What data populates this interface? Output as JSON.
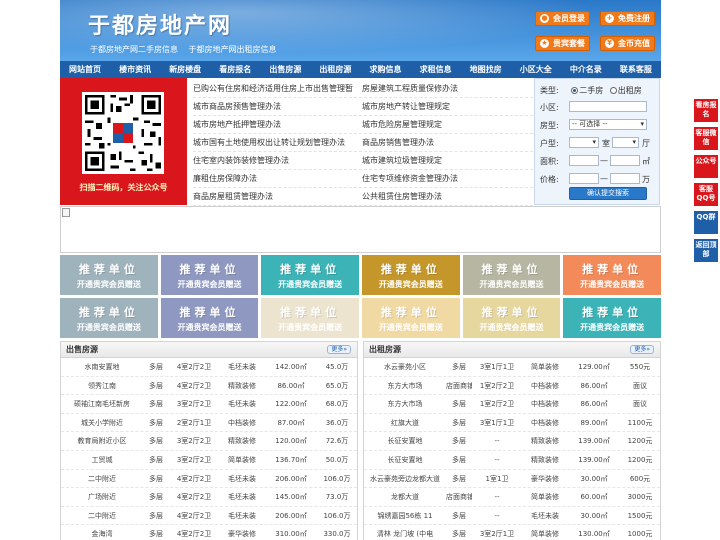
{
  "header": {
    "title": "于都房地产网",
    "sub_links": [
      "于都房地产网二手房信息",
      "于都房地产网出租房信息"
    ],
    "buttons": [
      {
        "label": "会员登录",
        "icon": "user-icon"
      },
      {
        "label": "免费注册",
        "icon": "register-icon"
      },
      {
        "label": "贵宾套餐",
        "icon": "vip-icon"
      },
      {
        "label": "金币充值",
        "icon": "coin-icon"
      }
    ]
  },
  "nav": [
    "网站首页",
    "楼市资讯",
    "新房楼盘",
    "看房报名",
    "出售房源",
    "出租房源",
    "求购信息",
    "求租信息",
    "地图找房",
    "小区大全",
    "中介名录",
    "联系客服"
  ],
  "qr": {
    "caption": "扫描二维码，关注公众号"
  },
  "links": [
    [
      "已购公有住房和经济适用住房上市出售管理暂",
      "房屋建筑工程质量保修办法"
    ],
    [
      "城市商品房预售管理办法",
      "城市房地产转让管理规定"
    ],
    [
      "城市房地产抵押管理办法",
      "城市危险房屋管理规定"
    ],
    [
      "城市国有土地使用权出让转让规划管理办法",
      "商品房销售管理办法"
    ],
    [
      "住宅室内装饰装修管理办法",
      "城市建筑垃圾管理规定"
    ],
    [
      "廉租住房保障办法",
      "住宅专项维修资金管理办法"
    ],
    [
      "商品房屋租赁管理办法",
      "公共租赁住房管理办法"
    ]
  ],
  "search": {
    "type_label": "类型:",
    "type_options": [
      "二手房",
      "出租房"
    ],
    "community_label": "小区:",
    "room_type_label": "房型:",
    "room_type_value": "-- 可选择 --",
    "layout_label": "户型:",
    "room_unit": "室",
    "hall_unit": "厅",
    "area_label": "面积:",
    "area_unit": "㎡",
    "area_sep": "—",
    "price_label": "价格:",
    "price_unit": "万",
    "price_sep": "—",
    "submit_label": "确认提交搜索"
  },
  "ads": {
    "line1": "推荐单位",
    "line2": "开通贵宾会员赠送",
    "colors": [
      "#9fb3bd",
      "#8e98c0",
      "#3bb3b7",
      "#c5962a",
      "#b6b6a2",
      "#f28a5a",
      "#9fb3bd",
      "#8e98c0",
      "#ede4cf",
      "#f1d9a4",
      "#e6d79f",
      "#3bb3b7"
    ]
  },
  "sale": {
    "title": "出售房源",
    "more": "更多»",
    "rows": [
      [
        "水南安置地",
        "多层",
        "4室2厅2卫",
        "毛坯未装",
        "142.00㎡",
        "45.0万"
      ],
      [
        "领秀江南",
        "多层",
        "4室2厅2卫",
        "精致装修",
        "86.00㎡",
        "65.0万"
      ],
      [
        "硕袖江南毛坯新房",
        "多层",
        "3室2厅2卫",
        "毛坯未装",
        "122.00㎡",
        "68.0万"
      ],
      [
        "城关小学附近",
        "多层",
        "2室2厅1卫",
        "中档装修",
        "87.00㎡",
        "36.0万"
      ],
      [
        "教育局附近小区",
        "多层",
        "3室2厅2卫",
        "精致装修",
        "120.00㎡",
        "72.6万"
      ],
      [
        "工贸城",
        "多层",
        "3室2厅2卫",
        "简单装修",
        "136.70㎡",
        "50.0万"
      ],
      [
        "二中附近",
        "多层",
        "4室2厅2卫",
        "毛坯未装",
        "206.00㎡",
        "106.0万"
      ],
      [
        "广场附近",
        "多层",
        "4室2厅2卫",
        "毛坯未装",
        "145.00㎡",
        "73.0万"
      ],
      [
        "二中附近",
        "多层",
        "4室2厅2卫",
        "毛坯未装",
        "206.00㎡",
        "106.0万"
      ],
      [
        "金海湾",
        "多层",
        "4室2厅2卫",
        "豪华装修",
        "310.00㎡",
        "330.0万"
      ]
    ]
  },
  "rent": {
    "title": "出租房源",
    "more": "更多»",
    "rows": [
      [
        "水云豪苑小区",
        "多层",
        "3室1厅1卫",
        "简单装修",
        "129.00㎡",
        "550元"
      ],
      [
        "东方大市场",
        "店面商铺",
        "1室2厅2卫",
        "中档装修",
        "86.00㎡",
        "面议"
      ],
      [
        "东方大市场",
        "多层",
        "1室2厅2卫",
        "中档装修",
        "86.00㎡",
        "面议"
      ],
      [
        "红旗大道",
        "多层",
        "3室1厅1卫",
        "中档装修",
        "89.00㎡",
        "1100元"
      ],
      [
        "长征安置地",
        "多层",
        "--",
        "精致装修",
        "139.00㎡",
        "1200元"
      ],
      [
        "长征安置地",
        "多层",
        "--",
        "精致装修",
        "139.00㎡",
        "1200元"
      ],
      [
        "水云豪苑旁边龙都大道",
        "多层",
        "1室1卫",
        "豪华装修",
        "30.00㎡",
        "600元"
      ],
      [
        "龙都大道",
        "店面商铺",
        "--",
        "简单装修",
        "60.00㎡",
        "3000元"
      ],
      [
        "锦绣嘉园56栋 11",
        "多层",
        "--",
        "毛坯未装",
        "30.00㎡",
        "1500元"
      ],
      [
        "清林 龙门坡 (中电",
        "多层",
        "3室2厅1卫",
        "简单装修",
        "130.00㎡",
        "1000元"
      ]
    ]
  },
  "float_bar": [
    "看房报名",
    "客服微信",
    "公众号",
    "客服QQ号",
    "QQ群",
    "返回顶部"
  ]
}
